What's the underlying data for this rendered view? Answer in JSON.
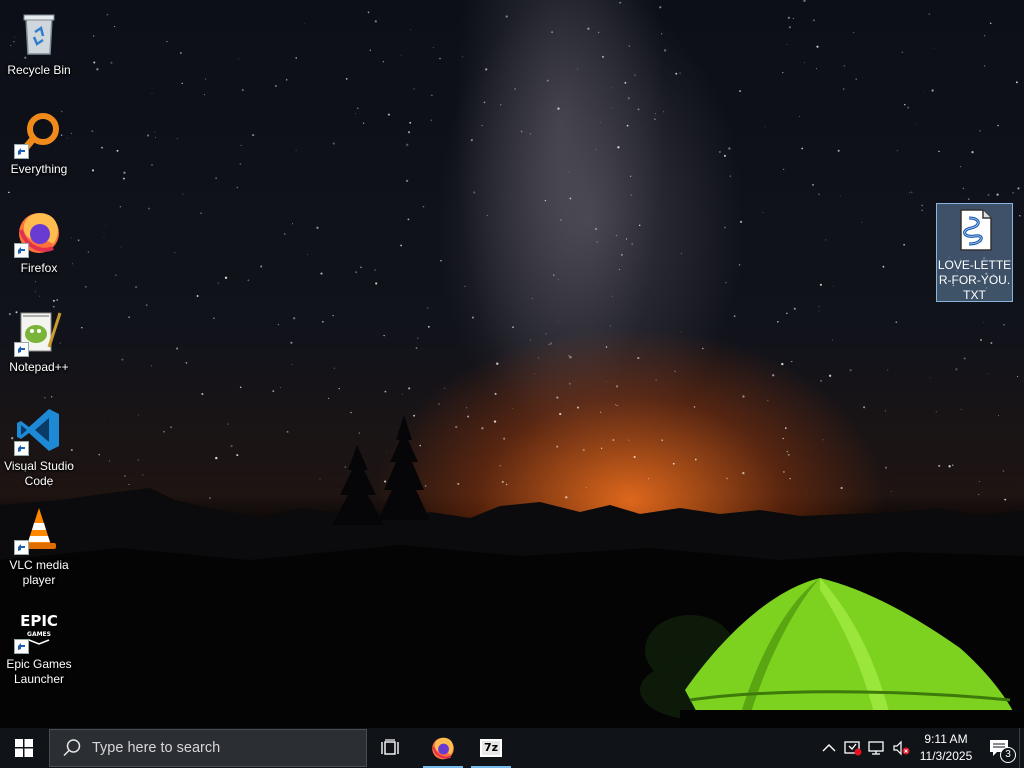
{
  "desktop": {
    "icons": [
      {
        "label": "Recycle Bin",
        "icon": "recycle-bin-icon"
      },
      {
        "label": "Everything",
        "icon": "everything-search-icon"
      },
      {
        "label": "Firefox",
        "icon": "firefox-icon"
      },
      {
        "label": "Notepad++",
        "icon": "notepad-plus-plus-icon"
      },
      {
        "label": "Visual Studio Code",
        "icon": "vscode-icon"
      },
      {
        "label": "VLC media player",
        "icon": "vlc-icon"
      },
      {
        "label": "Epic Games Launcher",
        "icon": "epic-games-icon"
      }
    ],
    "files": [
      {
        "label": "LOVE-LETTER-FOR-YOU.TXT",
        "icon": "text-file-icon",
        "selected": true
      }
    ],
    "wallpaper": "night sky milky way with green tent",
    "epic_logo_text": [
      "EPIC",
      "GAMES"
    ]
  },
  "taskbar": {
    "search_placeholder": "Type here to search",
    "apps": [
      {
        "name": "Firefox",
        "icon": "firefox-icon",
        "running": true
      },
      {
        "name": "7-Zip",
        "icon": "7zip-icon",
        "label": "7z",
        "running": true
      }
    ],
    "tray": {
      "icons": [
        "chevron-up-icon",
        "security-warning-icon",
        "network-icon",
        "volume-muted-icon"
      ],
      "time": "9:11 AM",
      "date": "11/3/2025",
      "notification_count": "3"
    },
    "colors": {
      "background": "#101418",
      "accent": "#76b9ed",
      "search_bg": "#2b2f33"
    }
  }
}
